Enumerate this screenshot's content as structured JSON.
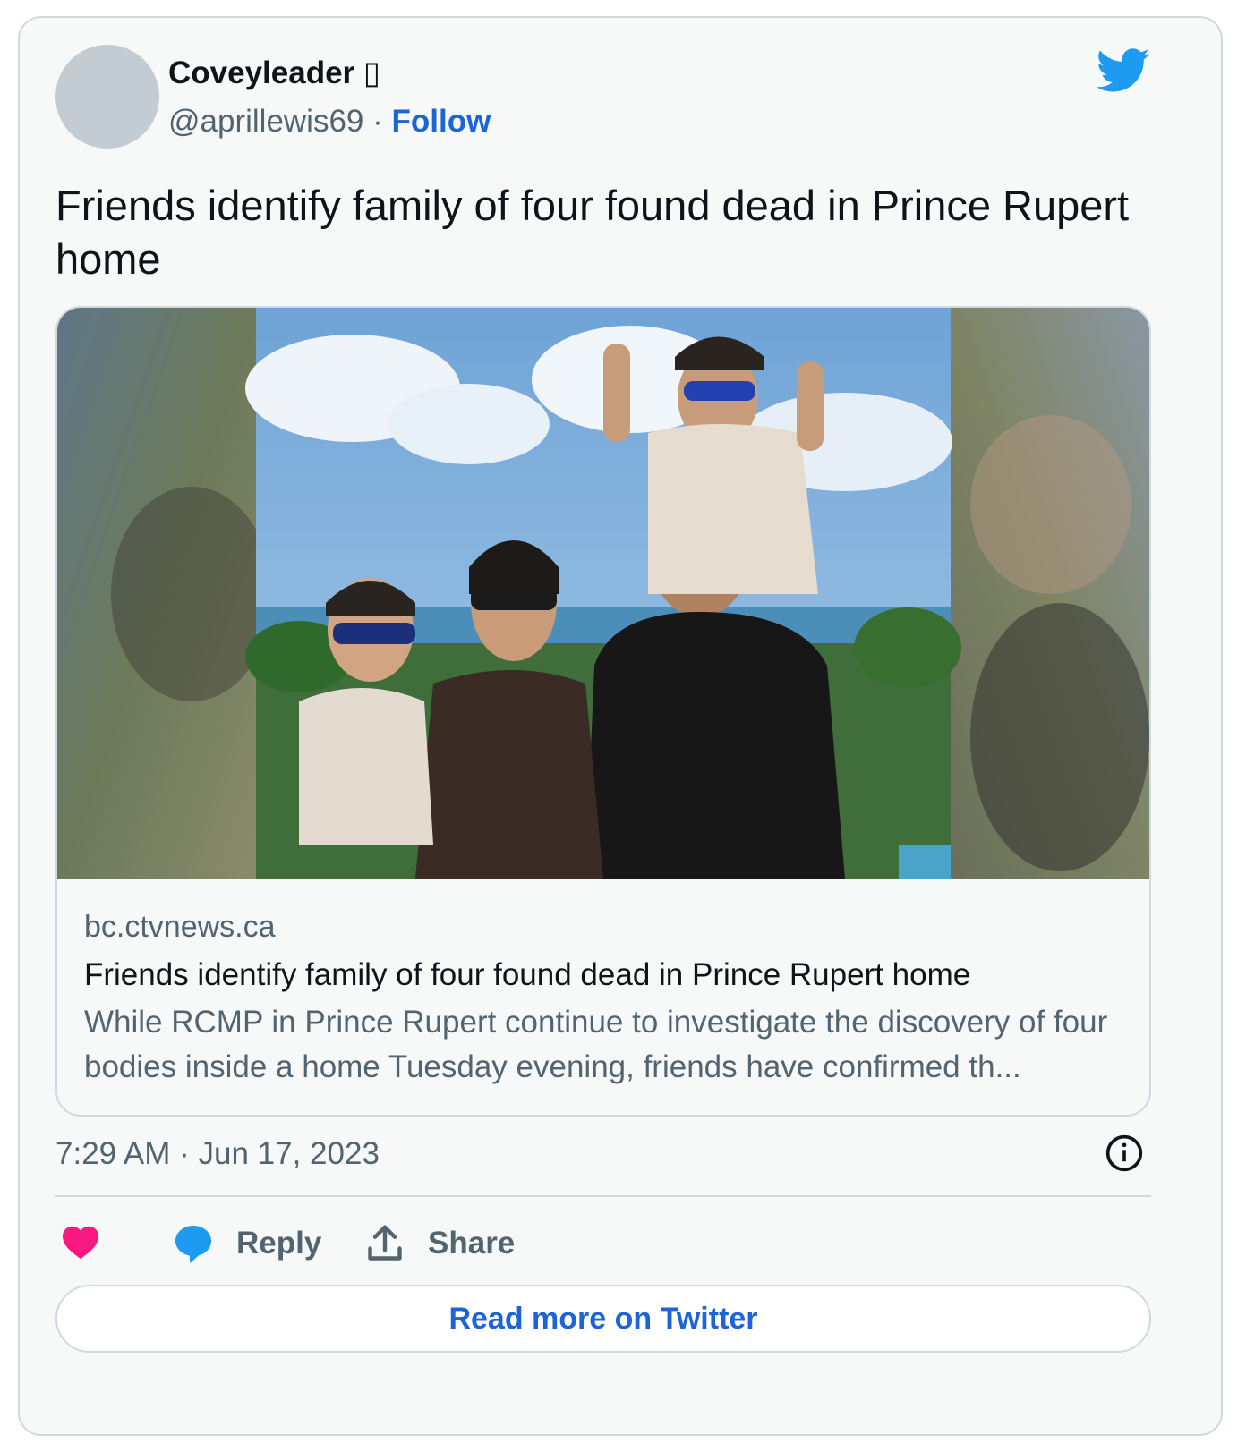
{
  "author": {
    "display_name": "Coveyleader ▯",
    "handle": "@aprillewis69",
    "separator": " · ",
    "follow_label": "Follow"
  },
  "tweet": {
    "text": "Friends identify family of four found dead in Prince Rupert home",
    "timestamp": "7:29 AM · Jun 17, 2023"
  },
  "link_card": {
    "domain": "bc.ctvnews.ca",
    "title": "Friends identify family of four found dead in Prince Rupert home",
    "description": "While RCMP in Prince Rupert continue to investigate the discovery of four bodies inside a home Tuesday evening, friends have confirmed th..."
  },
  "actions": {
    "reply_label": "Reply",
    "share_label": "Share"
  },
  "read_more_label": "Read more on Twitter",
  "colors": {
    "link_blue": "#1d64d8",
    "twitter_blue": "#1d9bf0",
    "like_pink": "#f91880",
    "muted_text": "#536471",
    "border": "#cfd9de"
  },
  "icons": [
    "twitter-bird-icon",
    "info-icon",
    "heart-icon",
    "speech-bubble-icon",
    "share-upload-icon"
  ]
}
